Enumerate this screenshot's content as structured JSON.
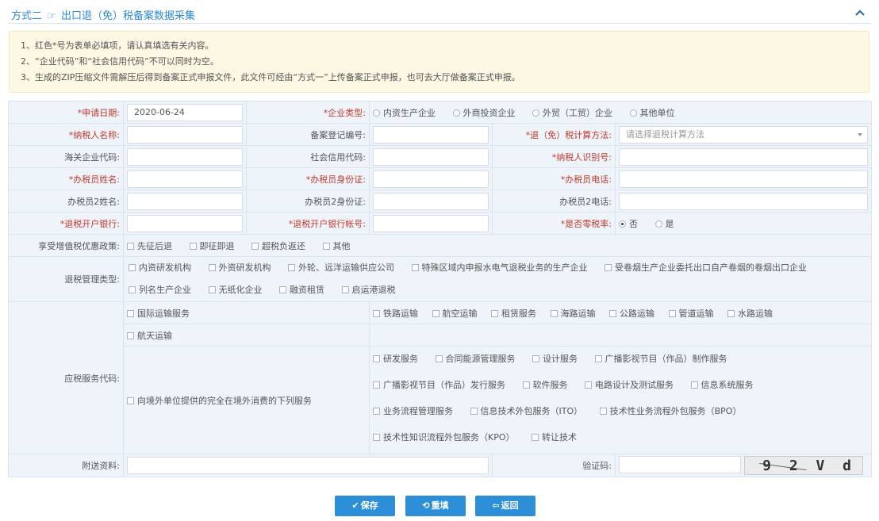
{
  "header": {
    "title": "方式二",
    "icon": "hand-pointer-icon",
    "subtitle": "出口退（免）税备案数据采集"
  },
  "notice": [
    "1、红色*号为表单必填项，请认真填选有关内容。",
    "2、“企业代码”和“社会信用代码”不可以同时为空。",
    "3、生成的ZIP压缩文件需解压后得到备案正式申报文件，此文件可经由“方式一”上传备案正式申报，也可去大厅做备案正式申报。"
  ],
  "form": {
    "apply_date_label": "*申请日期:",
    "apply_date_value": "2020-06-24",
    "enterprise_type_label": "*企业类型:",
    "enterprise_types": [
      "内资生产企业",
      "外商投资企业",
      "外贸（工贸）企业",
      "其他单位"
    ],
    "taxpayer_name_label": "*纳税人名称:",
    "record_no_label": "备案登记编号:",
    "refund_method_label": "*退（免）税计算方法:",
    "refund_method_placeholder": "请选择退税计算方法",
    "customs_code_label": "海关企业代码:",
    "credit_code_label": "社会信用代码:",
    "taxpayer_id_label": "*纳税人识别号:",
    "officer_name_label": "*办税员姓名:",
    "officer_id_label": "*办税员身份证:",
    "officer_phone_label": "*办税员电话:",
    "officer2_name_label": "办税员2姓名:",
    "officer2_id_label": "办税员2身份证:",
    "officer2_phone_label": "办税员2电话:",
    "bank_label": "*退税开户银行:",
    "bank_account_label": "*退税开户银行帐号:",
    "zero_rate_label": "*是否零税率:",
    "zero_rate_options": [
      "否",
      "是"
    ],
    "vat_policy_label": "享受增值税优惠政策:",
    "vat_policies": [
      "先征后退",
      "即征即退",
      "超税负返还",
      "其他"
    ],
    "mgmt_type_label": "退税管理类型:",
    "mgmt_types_row1": [
      "内资研发机构",
      "外资研发机构",
      "外轮、远洋运输供应公司",
      "特殊区域内申报水电气退税业务的生产企业",
      "受卷烟生产企业委托出口自产卷烟的卷烟出口企业"
    ],
    "mgmt_types_row2": [
      "列名生产企业",
      "无纸化企业",
      "融资租赁",
      "启运港退税"
    ],
    "service_code_label": "应税服务代码:",
    "svc_intl_transport": "国际运输服务",
    "svc_transport_modes": [
      "铁路运输",
      "航空运输",
      "租赁服务",
      "海路运输",
      "公路运输",
      "管道运输",
      "水路运输"
    ],
    "svc_aerospace": "航天运输",
    "svc_overseas": "向境外单位提供的完全在境外消费的下列服务",
    "svc_overseas_row1": [
      "研发服务",
      "合同能源管理服务",
      "设计服务",
      "广播影视节目（作品）制作服务"
    ],
    "svc_overseas_row2": [
      "广播影视节目（作品）发行服务",
      "软件服务",
      "电路设计及测试服务",
      "信息系统服务"
    ],
    "svc_overseas_row3": [
      "业务流程管理服务",
      "信息技术外包服务（ITO）",
      "技术性业务流程外包服务（BPO）"
    ],
    "svc_overseas_row4": [
      "技术性知识流程外包服务（KPO）",
      "转让技术"
    ],
    "attachment_label": "附送资料:",
    "captcha_label": "验证码:",
    "captcha_text": "9 2 V d"
  },
  "buttons": {
    "save": "保存",
    "reset": "重填",
    "back": "返回"
  },
  "colors": {
    "accent": "#2c8fd8",
    "required": "#c0392b",
    "notice_bg": "#fcf8e3"
  }
}
